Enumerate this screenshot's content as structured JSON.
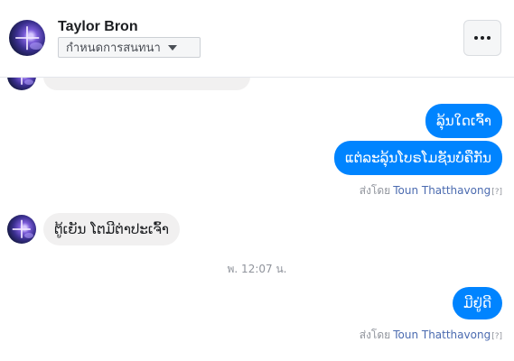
{
  "header": {
    "contact_name": "Taylor Bron",
    "chat_settings_label": "กำหนดการสนทนา"
  },
  "messages": {
    "partial_in_text": "",
    "out_1": "ລຸ້ນໃດເຈົ້າ",
    "out_2": "ແຕ່ລະລຸ້ນໂບຣໂມຊັນບໍ່ຄືກັນ",
    "sent_by_1": {
      "prefix": "ส่งโดย",
      "name": "Toun Thatthavong",
      "help": "[?]"
    },
    "in_1": "ຕູ້ເຍັນ ໂຕມີຕ່າປະເຈົ້າ",
    "timestamp_1": "พ. 12:07 น.",
    "out_3": "ມີຢູ່ດີ",
    "sent_by_2": {
      "prefix": "ส่งโดย",
      "name": "Toun Thatthavong",
      "help": "[?]"
    },
    "timestamp_2": ""
  },
  "colors": {
    "outgoing_bubble": "#0084ff",
    "incoming_bubble": "#f1f0f0",
    "sender_name": "#4b6bb0"
  }
}
